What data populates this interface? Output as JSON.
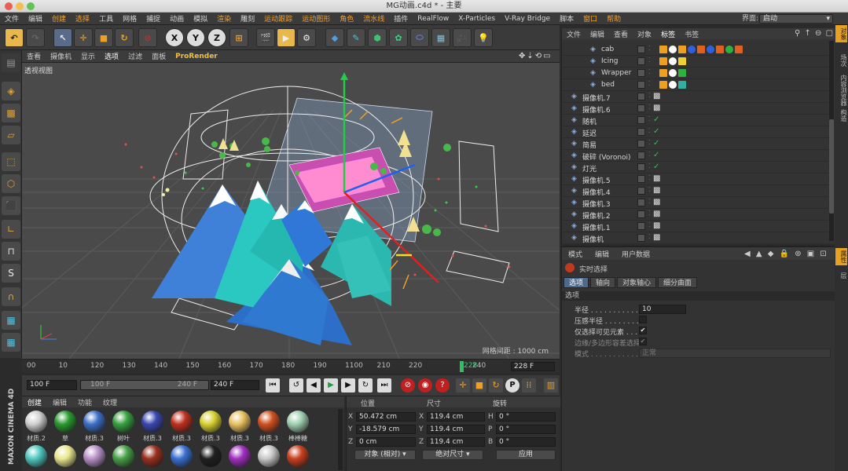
{
  "window": {
    "title": "MG动画.c4d * - 主要"
  },
  "menubar": {
    "items": [
      "文件",
      "编辑",
      "创建",
      "选择",
      "工具",
      "网格",
      "捕捉",
      "动画",
      "模拟",
      "渲染",
      "雕刻",
      "运动跟踪",
      "运动图形",
      "角色",
      "流水线",
      "插件",
      "RealFlow",
      "X-Particles",
      "V-Ray Bridge",
      "脚本",
      "窗口",
      "帮助"
    ],
    "highlighted": [
      "创建",
      "选择",
      "渲染",
      "运动跟踪",
      "运动图形",
      "角色",
      "流水线",
      "窗口",
      "帮助"
    ],
    "layout_label": "界面:",
    "layout_value": "启动"
  },
  "viewport": {
    "menu": [
      "查看",
      "摄像机",
      "显示",
      "选项",
      "过滤",
      "面板",
      "ProRender"
    ],
    "selected_menu": "选项",
    "view_name": "透视视图",
    "grid_spacing": "网格间距 : 1000 cm"
  },
  "timeline": {
    "ticks": [
      "00",
      "10",
      "120",
      "130",
      "140",
      "150",
      "160",
      "170",
      "180",
      "190",
      "1100",
      "210",
      "220",
      "228",
      "240"
    ],
    "current_frame": "228",
    "current_frame_field": "228 F"
  },
  "transport": {
    "start": "100 F",
    "range_start": "100 F",
    "range_end": "240 F",
    "end": "240 F"
  },
  "materials": {
    "tabs": [
      "创建",
      "编辑",
      "功能",
      "纹理"
    ],
    "row1": [
      {
        "label": "材质.2",
        "color": "#d0d0d0"
      },
      {
        "label": "草",
        "color": "#2a9a30"
      },
      {
        "label": "材质.3",
        "color": "#3d70c8"
      },
      {
        "label": "树叶",
        "color": "#38a040"
      },
      {
        "label": "材质.3",
        "color": "#3a48b0"
      },
      {
        "label": "材质.3",
        "color": "#c03020"
      },
      {
        "label": "材质.3",
        "color": "#d8d030"
      },
      {
        "label": "材质.3",
        "color": "#e8c060"
      },
      {
        "label": "材质.3",
        "color": "#d05020"
      },
      {
        "label": "棒棒糖",
        "color": "#a0d0b0"
      }
    ],
    "row2": [
      "#50c8c0",
      "#e8e890",
      "#b890c8",
      "#48a048",
      "#9a3020",
      "#3a70d0",
      "#202020",
      "#a030c0",
      "#c8c8c8",
      "#c84020"
    ]
  },
  "coordinates": {
    "headers": [
      "位置",
      "尺寸",
      "旋转"
    ],
    "rows": [
      {
        "axis": "X",
        "pos": "50.472 cm",
        "size_axis": "X",
        "size": "119.4 cm",
        "rot_axis": "H",
        "rot": "0 °"
      },
      {
        "axis": "Y",
        "pos": "-18.579 cm",
        "size_axis": "Y",
        "size": "119.4 cm",
        "rot_axis": "P",
        "rot": "0 °"
      },
      {
        "axis": "Z",
        "pos": "0 cm",
        "size_axis": "Z",
        "size": "119.4 cm",
        "rot_axis": "B",
        "rot": "0 °"
      }
    ],
    "mode1": "对象 (相对)",
    "mode2": "绝对尺寸",
    "apply": "应用"
  },
  "object_manager": {
    "menu": [
      "文件",
      "编辑",
      "查看",
      "对象",
      "标签",
      "书签"
    ],
    "selected_menu": "标签",
    "objects": [
      {
        "name": "cab",
        "indent": 2
      },
      {
        "name": "Icing",
        "indent": 2
      },
      {
        "name": "Wrapper",
        "indent": 2
      },
      {
        "name": "bed",
        "indent": 2
      },
      {
        "name": "摄像机.7",
        "indent": 0
      },
      {
        "name": "摄像机.6",
        "indent": 0
      },
      {
        "name": "随机",
        "indent": 0
      },
      {
        "name": "延迟",
        "indent": 0
      },
      {
        "name": "简易",
        "indent": 0
      },
      {
        "name": "破碎 (Voronoi)",
        "indent": 0
      },
      {
        "name": "灯光",
        "indent": 0
      },
      {
        "name": "摄像机.5",
        "indent": 0
      },
      {
        "name": "摄像机.4",
        "indent": 0
      },
      {
        "name": "摄像机.3",
        "indent": 0
      },
      {
        "name": "摄像机.2",
        "indent": 0
      },
      {
        "name": "摄像机.1",
        "indent": 0
      },
      {
        "name": "摄像机",
        "indent": 0
      }
    ]
  },
  "attributes": {
    "menu": [
      "模式",
      "编辑",
      "用户数据"
    ],
    "title": "实时选择",
    "tabs": [
      "选项",
      "轴向",
      "对象轴心",
      "细分曲面"
    ],
    "selected_tab": "选项",
    "section": "选项",
    "fields": [
      {
        "label": "半径 . . . . . . . . . . . .",
        "value": "10"
      },
      {
        "label": "压感半径 . . . . . . . . .",
        "value": ""
      },
      {
        "label": "仅选择可见元素 . . . . .",
        "value": "✔"
      },
      {
        "label": "边缘/多边形容差选择",
        "value": "✔"
      },
      {
        "label": "模式 . . . . . . . . . . . .",
        "value": "正常"
      }
    ]
  },
  "right_tabs": [
    "对象",
    "场次",
    "内容浏览器",
    "构造",
    "属性",
    "层"
  ],
  "brand": "MAXON CINEMA 4D"
}
